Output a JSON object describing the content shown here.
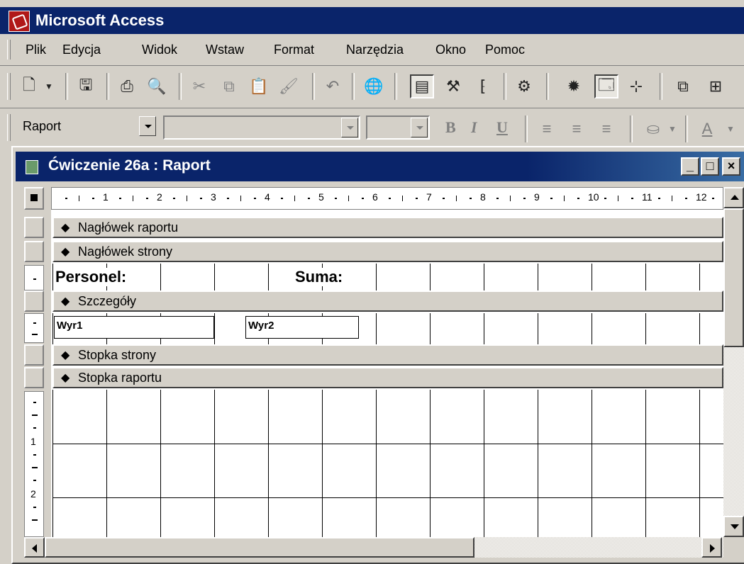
{
  "app": {
    "title": "Microsoft Access"
  },
  "menu": [
    "Plik",
    "Edycja",
    "Widok",
    "Wstaw",
    "Format",
    "Narzędzia",
    "Okno",
    "Pomoc"
  ],
  "toolbar2": {
    "object_select": "Raport",
    "font_select": "",
    "size_select": ""
  },
  "window": {
    "title": "Ćwiczenie 26a : Raport",
    "minimize": "_",
    "maximize": "□",
    "close": "×"
  },
  "ruler": {
    "labels": [
      "1",
      "2",
      "3",
      "4",
      "5",
      "6",
      "7",
      "8",
      "9",
      "10",
      "11",
      "12"
    ],
    "vertical_labels": [
      "1",
      "2"
    ]
  },
  "bands": {
    "report_header": "Nagłówek raportu",
    "page_header": "Nagłówek strony",
    "detail": "Szczegóły",
    "page_footer": "Stopka strony",
    "report_footer": "Stopka raportu"
  },
  "controls": {
    "personel_label": "Personel:",
    "suma_label": "Suma:",
    "field1": "Wyr1",
    "field2": "Wyr2"
  },
  "icons": [
    "print-preview-icon",
    "save-icon",
    "print-icon",
    "preview-icon",
    "cut-icon",
    "copy-icon",
    "paste-icon",
    "format-painter-icon",
    "undo-icon",
    "hyperlink-icon",
    "field-list-icon",
    "toolbox-icon",
    "sorting-grouping-icon",
    "autoformat-icon",
    "code-icon",
    "properties-icon",
    "build-icon",
    "database-window-icon",
    "new-object-icon"
  ],
  "format_buttons": {
    "bold": "B",
    "italic": "I",
    "underline": "U"
  }
}
